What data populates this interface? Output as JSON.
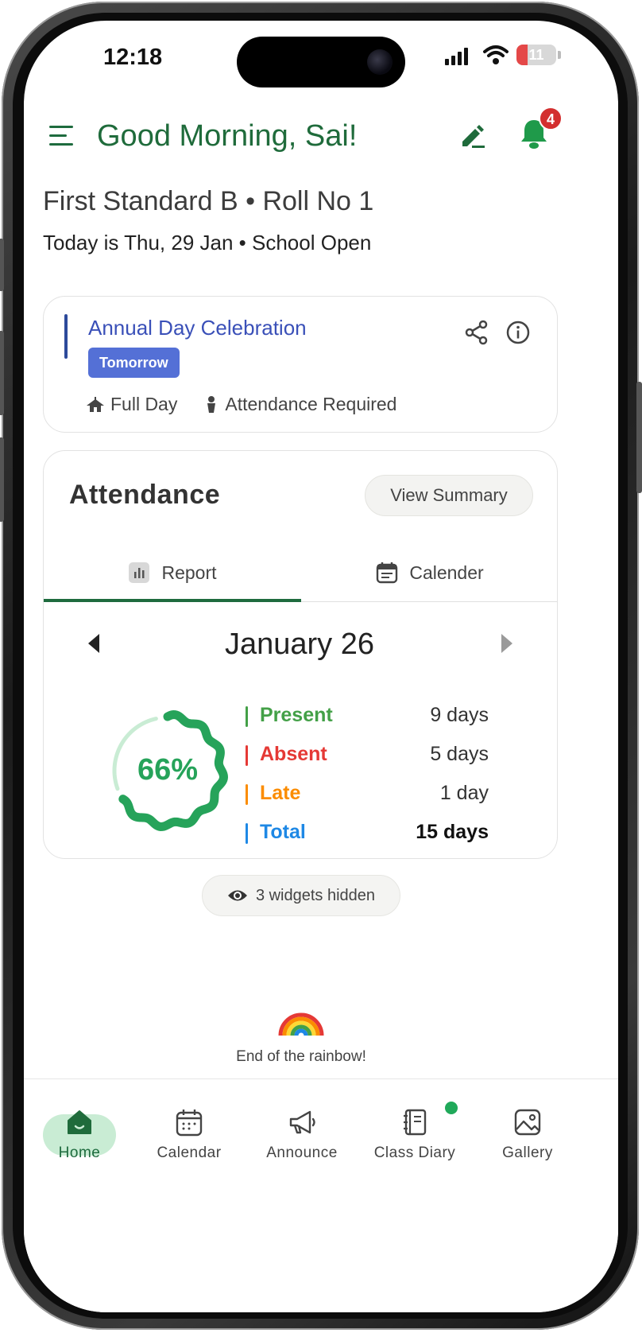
{
  "status": {
    "time": "12:18",
    "battery": "11"
  },
  "header": {
    "greeting": "Good Morning, Sai!",
    "notification_count": "4"
  },
  "student": {
    "class_line": "First Standard B • Roll No 1",
    "date_line": "Today is Thu, 29 Jan • School Open"
  },
  "event": {
    "title": "Annual Day Celebration",
    "tag": "Tomorrow",
    "duration": "Full Day",
    "attendance_note": "Attendance Required"
  },
  "attendance": {
    "title": "Attendance",
    "view_summary_label": "View Summary",
    "tabs": [
      {
        "label": "Report"
      },
      {
        "label": "Calender"
      }
    ],
    "active_tab": "Report",
    "month": "January 26",
    "percent_label": "66%",
    "percent": 66,
    "stats": [
      {
        "label": "Present",
        "value": "9 days",
        "color": "#43a047"
      },
      {
        "label": "Absent",
        "value": "5 days",
        "color": "#e53935"
      },
      {
        "label": "Late",
        "value": "1 day",
        "color": "#fb8c00"
      },
      {
        "label": "Total",
        "value": "15 days",
        "color": "#1e88e5"
      }
    ]
  },
  "widgets": {
    "hidden_label": "3 widgets hidden"
  },
  "footer": {
    "end_text": "End of the rainbow!"
  },
  "nav": {
    "items": [
      {
        "label": "Home",
        "icon": "home-icon"
      },
      {
        "label": "Calendar",
        "icon": "calendar-icon"
      },
      {
        "label": "Announce",
        "icon": "megaphone-icon"
      },
      {
        "label": "Class Diary",
        "icon": "diary-icon"
      },
      {
        "label": "Gallery",
        "icon": "gallery-icon"
      }
    ],
    "active": "Home"
  },
  "colors": {
    "brand_green": "#1f6b3b",
    "accent_blue": "#3a50b8",
    "ring_green": "#26a35a"
  }
}
